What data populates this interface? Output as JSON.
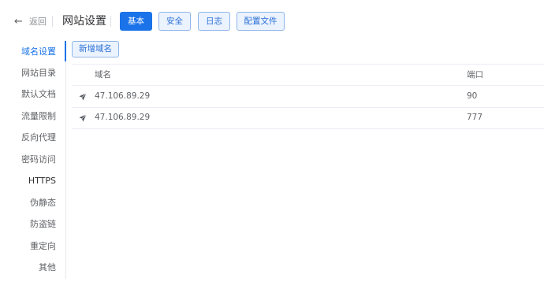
{
  "header": {
    "back_label": "返回",
    "title": "网站设置",
    "tabs": [
      {
        "label": "基本",
        "active": true
      },
      {
        "label": "安全",
        "active": false
      },
      {
        "label": "日志",
        "active": false
      },
      {
        "label": "配置文件",
        "active": false
      }
    ]
  },
  "sidebar": {
    "items": [
      {
        "label": "域名设置",
        "active": true
      },
      {
        "label": "网站目录",
        "active": false
      },
      {
        "label": "默认文档",
        "active": false
      },
      {
        "label": "流量限制",
        "active": false
      },
      {
        "label": "反向代理",
        "active": false
      },
      {
        "label": "密码访问",
        "active": false
      },
      {
        "label": "HTTPS",
        "active": false
      },
      {
        "label": "伪静态",
        "active": false
      },
      {
        "label": "防盗链",
        "active": false
      },
      {
        "label": "重定向",
        "active": false
      },
      {
        "label": "其他",
        "active": false
      }
    ]
  },
  "main": {
    "add_domain_label": "新增域名",
    "table": {
      "columns": [
        "域名",
        "端口"
      ],
      "rows": [
        {
          "domain": "47.106.89.29",
          "port": "90",
          "icon": "send-icon"
        },
        {
          "domain": "47.106.89.29",
          "port": "777",
          "icon": "send-icon"
        }
      ]
    }
  },
  "colors": {
    "accent": "#1a73e8",
    "tab_bg": "#ebf3fe",
    "text": "#606266",
    "border": "#ebeef5"
  }
}
